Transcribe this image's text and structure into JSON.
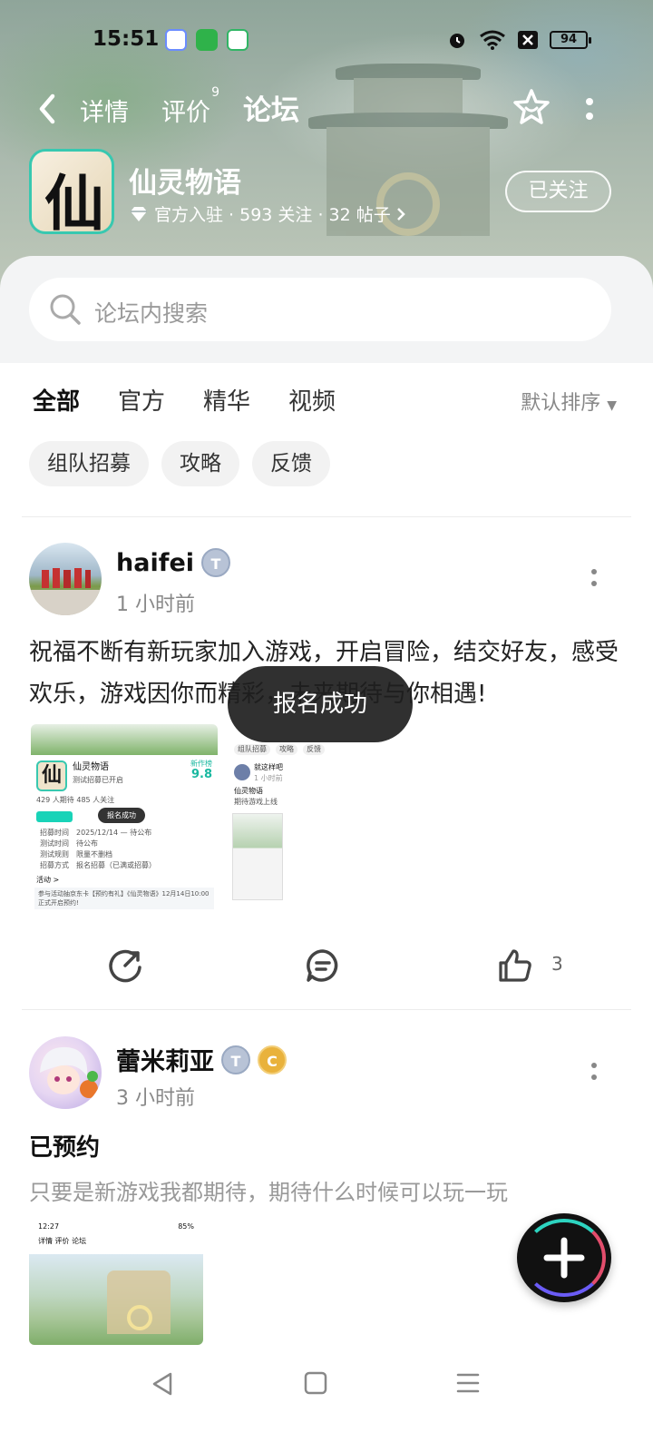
{
  "status_bar": {
    "time": "15:51",
    "battery": "94",
    "icons": [
      "alarm-icon",
      "wifi-icon",
      "no-sim-icon",
      "battery-icon"
    ]
  },
  "nav": {
    "tabs": [
      {
        "label": "详情",
        "badge": ""
      },
      {
        "label": "评价",
        "badge": "9"
      },
      {
        "label": "论坛",
        "badge": ""
      }
    ],
    "active_tab": "论坛"
  },
  "game": {
    "icon_glyph": "仙",
    "name": "仙灵物语",
    "meta": "官方入驻 · 593 关注 · 32 帖子",
    "follow_label": "已关注"
  },
  "search": {
    "placeholder": "论坛内搜索"
  },
  "tabs": {
    "items": [
      "全部",
      "官方",
      "精华",
      "视频"
    ],
    "active": "全部",
    "sort_label": "默认排序"
  },
  "chips": [
    "组队招募",
    "攻略",
    "反馈"
  ],
  "posts": [
    {
      "username": "haifei",
      "time": "1 小时前",
      "text": "祝福不断有新玩家加入游戏，开启冒险，结交好友，感受欢乐，游戏因你而精彩，未来期待与你相遇!",
      "likes": "3",
      "thumb1": {
        "game_name": "仙灵物语",
        "score": "9.8",
        "score_label": "新作榜",
        "line1": "测试招募已开启",
        "stats": "429 人期待   485 人关注",
        "toast": "报名成功",
        "rows": [
          [
            "招募时间",
            "2025/12/14 — 待公布"
          ],
          [
            "测试时间",
            "待公布"
          ],
          [
            "测试规则",
            "限量不删档"
          ],
          [
            "招募方式",
            "报名招募（已满或招募）"
          ]
        ],
        "activity": "活动 >",
        "promo": "参与活动抽京东卡【预约有礼】《仙灵物语》12月14日10:00正式开启预约!"
      },
      "thumb2": {
        "chips": [
          "组队招募",
          "攻略",
          "反馈"
        ],
        "user": "就这样吧",
        "time": "1 小时前",
        "title": "仙灵物语",
        "sub": "期待游戏上线"
      }
    },
    {
      "username": "蕾米莉亚",
      "time": "3 小时前",
      "title": "已预约",
      "text": "只要是新游戏我都期待，期待什么时候可以玩一玩",
      "thumb": {
        "time": "12:27",
        "battery": "85%",
        "tabs": "详情  评价  论坛"
      }
    }
  ],
  "toast": "报名成功",
  "colors": {
    "accent": "#19d3b8",
    "text_primary": "#111111",
    "text_secondary": "#888888"
  }
}
